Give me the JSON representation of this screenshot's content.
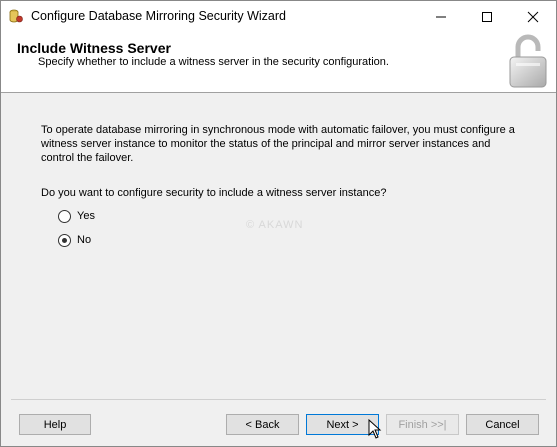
{
  "window": {
    "title": "Configure Database Mirroring Security Wizard"
  },
  "header": {
    "title": "Include Witness Server",
    "subtitle": "Specify whether to include a witness server in the security configuration."
  },
  "body": {
    "description": "To operate database mirroring in synchronous mode with automatic failover, you must configure a witness server instance to monitor the status of the principal and mirror server instances and control the failover.",
    "question": "Do you want to configure security to include a witness server instance?",
    "options": [
      {
        "label": "Yes",
        "selected": false
      },
      {
        "label": "No",
        "selected": true
      }
    ],
    "watermark": "© AKAWN"
  },
  "footer": {
    "help": "Help",
    "back": "< Back",
    "next": "Next >",
    "finish": "Finish >>|",
    "cancel": "Cancel"
  },
  "icons": {
    "app": "database-icon",
    "header": "padlock-open-icon",
    "minimize": "minimize-icon",
    "maximize": "maximize-icon",
    "close": "close-icon",
    "cursor": "mouse-pointer-icon"
  }
}
